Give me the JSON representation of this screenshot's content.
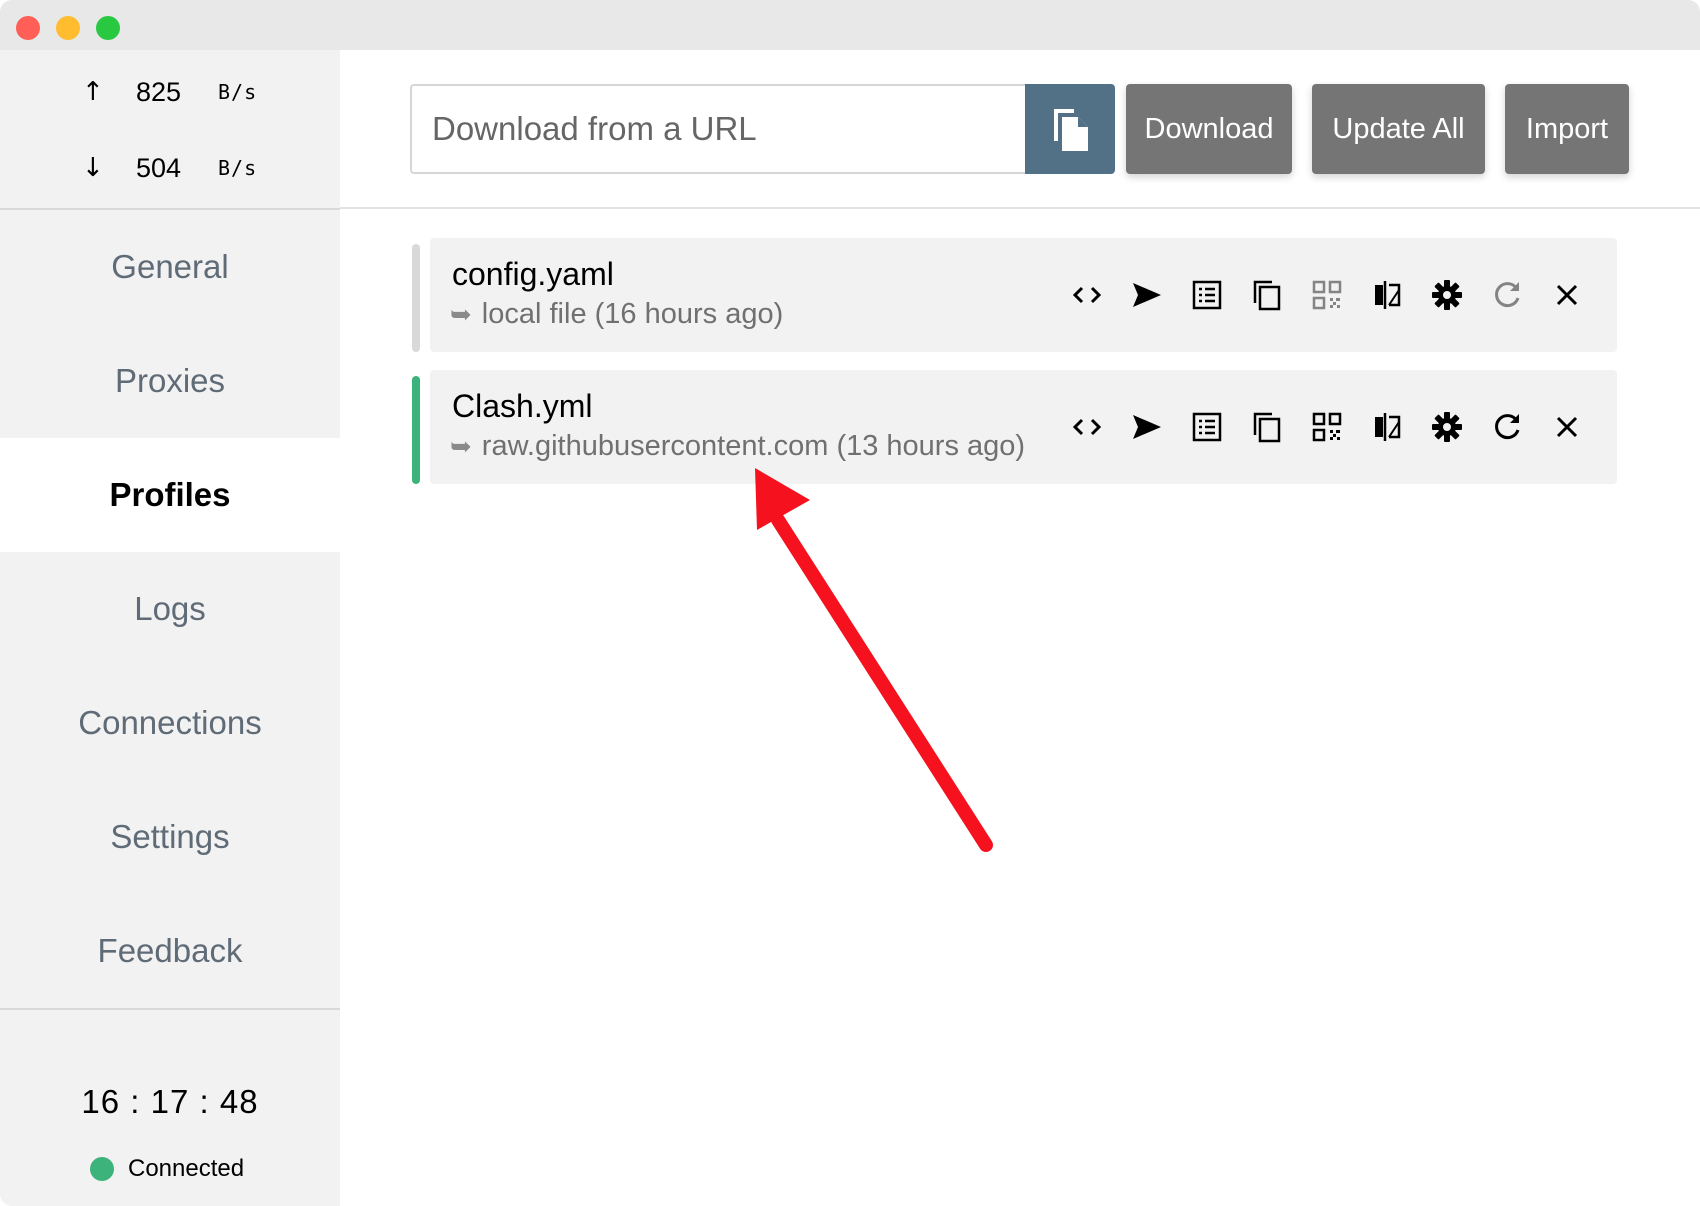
{
  "window": {
    "traffic_lights": [
      "close",
      "minimize",
      "zoom"
    ]
  },
  "sidebar": {
    "upload": {
      "arrow": "↑",
      "value": "825",
      "unit": "B/s"
    },
    "download": {
      "arrow": "↓",
      "value": "504",
      "unit": "B/s"
    },
    "items": [
      {
        "label": "General"
      },
      {
        "label": "Proxies"
      },
      {
        "label": "Profiles"
      },
      {
        "label": "Logs"
      },
      {
        "label": "Connections"
      },
      {
        "label": "Settings"
      },
      {
        "label": "Feedback"
      }
    ],
    "active_item": "Profiles",
    "clock": "16 : 17 : 48",
    "status": "Connected",
    "status_color": "#3cb37a"
  },
  "toolbar": {
    "url_placeholder": "Download from a URL",
    "url_value": "",
    "paste_icon": "paste-icon",
    "download_label": "Download",
    "update_all_label": "Update All",
    "import_label": "Import"
  },
  "profiles": [
    {
      "name": "config.yaml",
      "source_icon": "➥",
      "source": "local file (16 hours ago)",
      "selected": false,
      "indicator_color": "#d9d9d9"
    },
    {
      "name": "Clash.yml",
      "source_icon": "➥",
      "source": "raw.githubusercontent.com (13 hours ago)",
      "selected": true,
      "indicator_color": "#3cb37a"
    }
  ],
  "profile_actions": [
    "code-icon",
    "send-icon",
    "list-icon",
    "copy-icon",
    "qr-code-icon",
    "compare-icon",
    "gear-icon",
    "refresh-icon",
    "close-icon"
  ],
  "colors": {
    "accent": "#527186",
    "button": "#757575",
    "annotation_arrow": "#f5111d"
  }
}
